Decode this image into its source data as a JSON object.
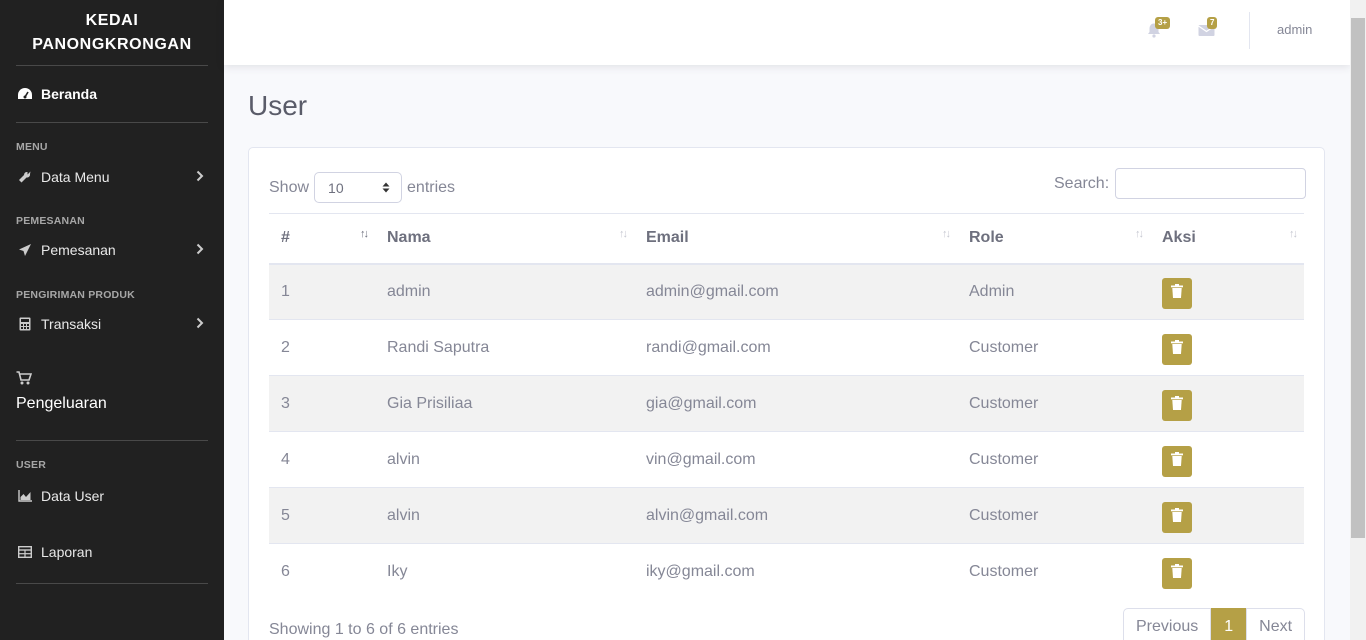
{
  "sidebar": {
    "brand_line1": "KEDAI",
    "brand_line2": "PANONGKRONGAN",
    "dashboard": "Beranda",
    "heading_menu": "MENU",
    "data_menu": "Data Menu",
    "heading_pemesanan": "PEMESANAN",
    "pemesanan": "Pemesanan",
    "heading_pengiriman": "PENGIRIMAN PRODUK",
    "transaksi": "Transaksi",
    "pengeluaran": "Pengeluaran",
    "heading_user": "USER",
    "data_user": "Data User",
    "laporan": "Laporan"
  },
  "topbar": {
    "alerts_badge": "3+",
    "messages_badge": "7",
    "user": "admin"
  },
  "page": {
    "title": "User"
  },
  "table_controls": {
    "show_label": "Show",
    "page_size": "10",
    "entries_label": "entries",
    "search_label": "Search:",
    "search_value": ""
  },
  "table": {
    "columns": [
      "#",
      "Nama",
      "Email",
      "Role",
      "Aksi"
    ],
    "rows": [
      {
        "no": "1",
        "nama": "admin",
        "email": "admin@gmail.com",
        "role": "Admin"
      },
      {
        "no": "2",
        "nama": "Randi Saputra",
        "email": "randi@gmail.com",
        "role": "Customer"
      },
      {
        "no": "3",
        "nama": "Gia Prisiliaa",
        "email": "gia@gmail.com",
        "role": "Customer"
      },
      {
        "no": "4",
        "nama": "alvin",
        "email": "vin@gmail.com",
        "role": "Customer"
      },
      {
        "no": "5",
        "nama": "alvin",
        "email": "alvin@gmail.com",
        "role": "Customer"
      },
      {
        "no": "6",
        "nama": "Iky",
        "email": "iky@gmail.com",
        "role": "Customer"
      }
    ]
  },
  "footer": {
    "info": "Showing 1 to 6 of 6 entries",
    "previous": "Previous",
    "current_page": "1",
    "next": "Next"
  },
  "colors": {
    "accent": "#b5a046",
    "sidebar": "#212121"
  }
}
